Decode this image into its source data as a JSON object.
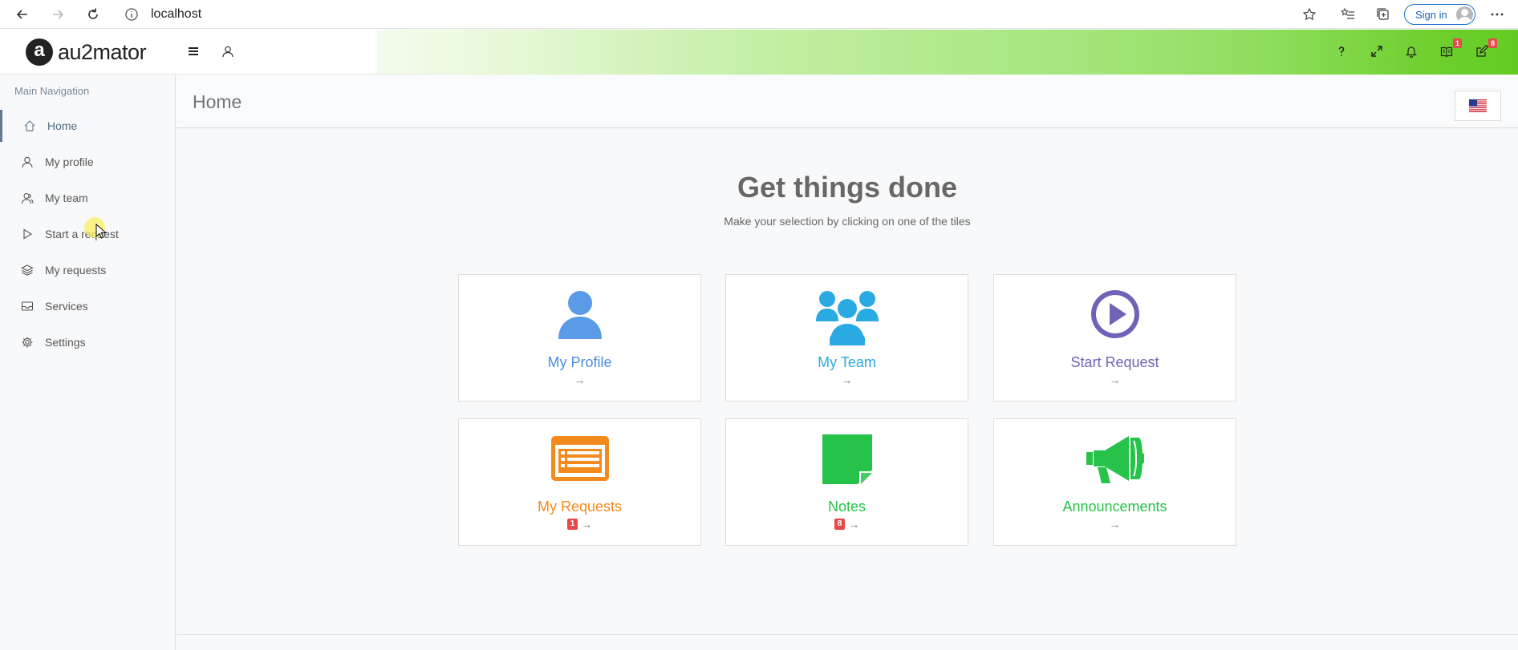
{
  "browser": {
    "url": "localhost",
    "sign_in_label": "Sign in"
  },
  "app": {
    "logo_text": "au2mator",
    "logo_letter": "a",
    "header_badges": {
      "requests": "1",
      "notes": "8"
    }
  },
  "sidebar": {
    "title": "Main Navigation",
    "items": [
      {
        "label": "Home",
        "icon": "home-icon"
      },
      {
        "label": "My profile",
        "icon": "user-icon"
      },
      {
        "label": "My team",
        "icon": "team-icon"
      },
      {
        "label": "Start a request",
        "icon": "play-icon"
      },
      {
        "label": "My requests",
        "icon": "layers-icon"
      },
      {
        "label": "Services",
        "icon": "inbox-icon"
      },
      {
        "label": "Settings",
        "icon": "gear-icon"
      }
    ]
  },
  "page": {
    "title": "Home",
    "heading": "Get things done",
    "subheading": "Make your selection by clicking on one of the tiles"
  },
  "tiles": [
    {
      "label": "My Profile",
      "arrow": "→",
      "color": "#4a8fe0",
      "icon": "user-icon"
    },
    {
      "label": "My Team",
      "arrow": "→",
      "color": "#29a9df",
      "icon": "team-icon"
    },
    {
      "label": "Start Request",
      "arrow": "→",
      "color": "#7062b6",
      "icon": "play-circle-icon"
    },
    {
      "label": "My Requests",
      "arrow": "→",
      "color": "#f28a1e",
      "icon": "list-icon",
      "badge": "1"
    },
    {
      "label": "Notes",
      "arrow": "→",
      "color": "#26c24a",
      "icon": "note-icon",
      "badge": "8"
    },
    {
      "label": "Announcements",
      "arrow": "→",
      "color": "#26c24a",
      "icon": "megaphone-icon"
    }
  ]
}
